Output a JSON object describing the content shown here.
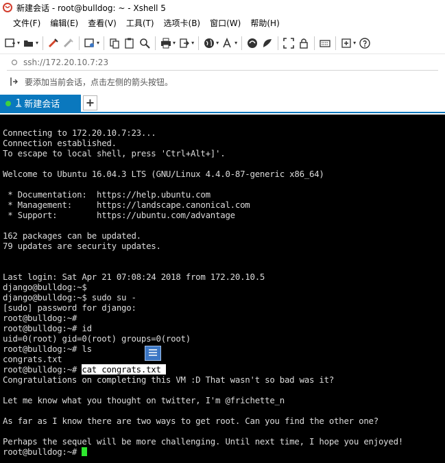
{
  "window": {
    "title": "新建会话 - root@bulldog: ~ - Xshell 5",
    "app_icon": "xshell-logo-icon",
    "accent_color": "#0a78be"
  },
  "menu": {
    "items": [
      "文件(F)",
      "编辑(E)",
      "查看(V)",
      "工具(T)",
      "选项卡(B)",
      "窗口(W)",
      "帮助(H)"
    ]
  },
  "toolbar": {
    "icons": [
      "new-session-icon",
      "open-folder-icon",
      "reconnect-icon",
      "disconnect-icon",
      "properties-icon",
      "copy-icon",
      "paste-icon",
      "find-icon",
      "print-icon",
      "transfer-icon",
      "globe-icon",
      "font-icon",
      "xftp-icon",
      "xmanager-icon",
      "fullscreen-icon",
      "lock-icon",
      "keyboard-icon",
      "add-icon",
      "help-icon"
    ]
  },
  "address": {
    "value": "ssh://172.20.10.7:23"
  },
  "hint": {
    "text": "要添加当前会话，点击左侧的箭头按钮。"
  },
  "tabs": [
    {
      "number": "1",
      "label": "新建会话",
      "status_color": "#3fd13f"
    }
  ],
  "terminal": {
    "cursor_color": "#2ee82e",
    "lines": [
      "Connecting to 172.20.10.7:23...",
      "Connection established.",
      "To escape to local shell, press 'Ctrl+Alt+]'.",
      "",
      "Welcome to Ubuntu 16.04.3 LTS (GNU/Linux 4.4.0-87-generic x86_64)",
      "",
      " * Documentation:  https://help.ubuntu.com",
      " * Management:     https://landscape.canonical.com",
      " * Support:        https://ubuntu.com/advantage",
      "",
      "162 packages can be updated.",
      "79 updates are security updates.",
      "",
      "",
      "Last login: Sat Apr 21 07:08:24 2018 from 172.20.10.5",
      "django@bulldog:~$",
      "django@bulldog:~$ sudo su -",
      "[sudo] password for django:",
      "root@bulldog:~#",
      "root@bulldog:~# id",
      "uid=0(root) gid=0(root) groups=0(root)",
      "root@bulldog:~# ls",
      "congrats.txt",
      "root@bulldog:~# ",
      "Congratulations on completing this VM :D That wasn't so bad was it?",
      "",
      "Let me know what you thought on twitter, I'm @frichette_n",
      "",
      "As far as I know there are two ways to get root. Can you find the other one?",
      "",
      "Perhaps the sequel will be more challenging. Until next time, I hope you enjoyed!",
      "root@bulldog:~# "
    ],
    "selected_command": "cat congrats.txt "
  }
}
